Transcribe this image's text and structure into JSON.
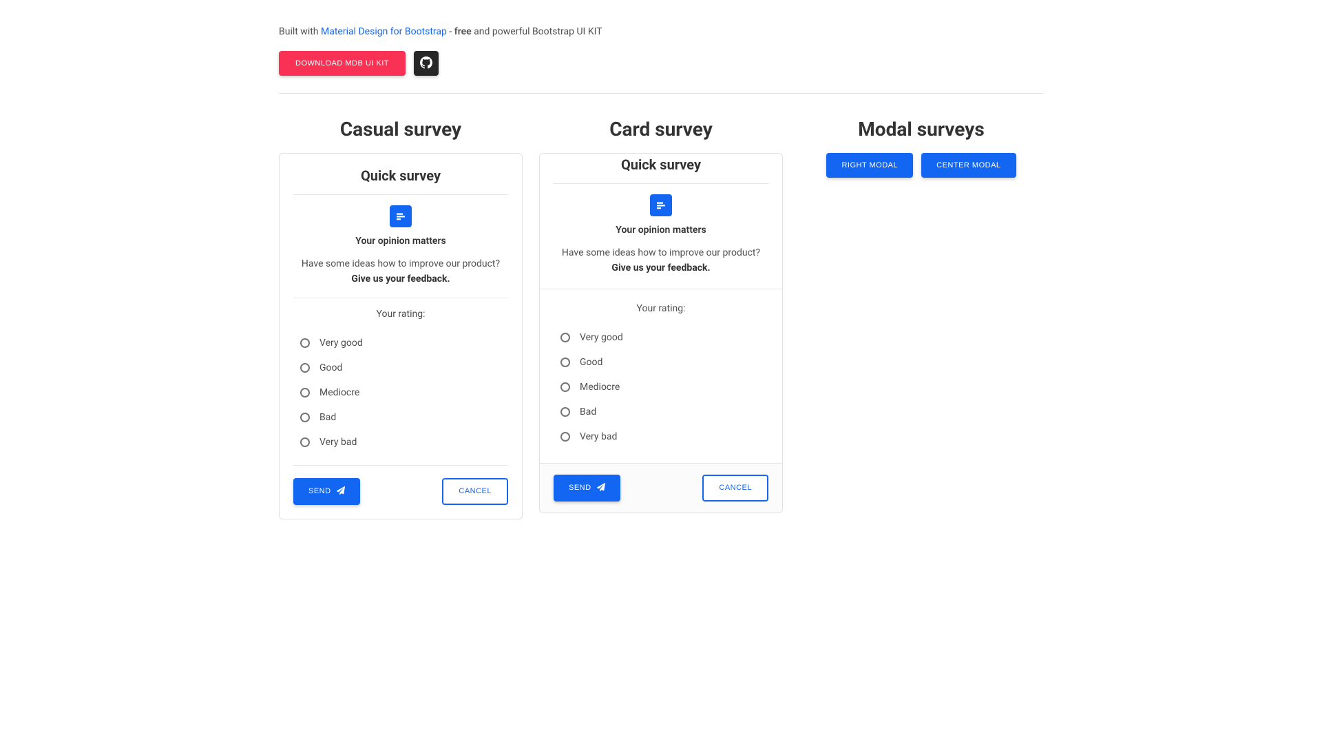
{
  "intro": {
    "prefix": "Built with ",
    "link_text": "Material Design for Bootstrap",
    "middle": " - ",
    "bold": "free",
    "suffix": " and powerful Bootstrap UI KIT"
  },
  "buttons": {
    "download": "DOWNLOAD MDB UI KIT"
  },
  "columns": {
    "casual_title": "Casual survey",
    "card_title": "Card survey",
    "modal_title": "Modal surveys"
  },
  "survey": {
    "title": "Quick survey",
    "opinion": "Your opinion matters",
    "help_prefix": "Have some ideas how to improve our product? ",
    "help_bold": "Give us your feedback.",
    "rating_label": "Your rating:",
    "options": {
      "opt0": "Very good",
      "opt1": "Good",
      "opt2": "Mediocre",
      "opt3": "Bad",
      "opt4": "Very bad"
    },
    "send": "SEND",
    "cancel": "CANCEL"
  },
  "modal_buttons": {
    "right": "RIGHT MODAL",
    "center": "CENTER MODAL"
  }
}
